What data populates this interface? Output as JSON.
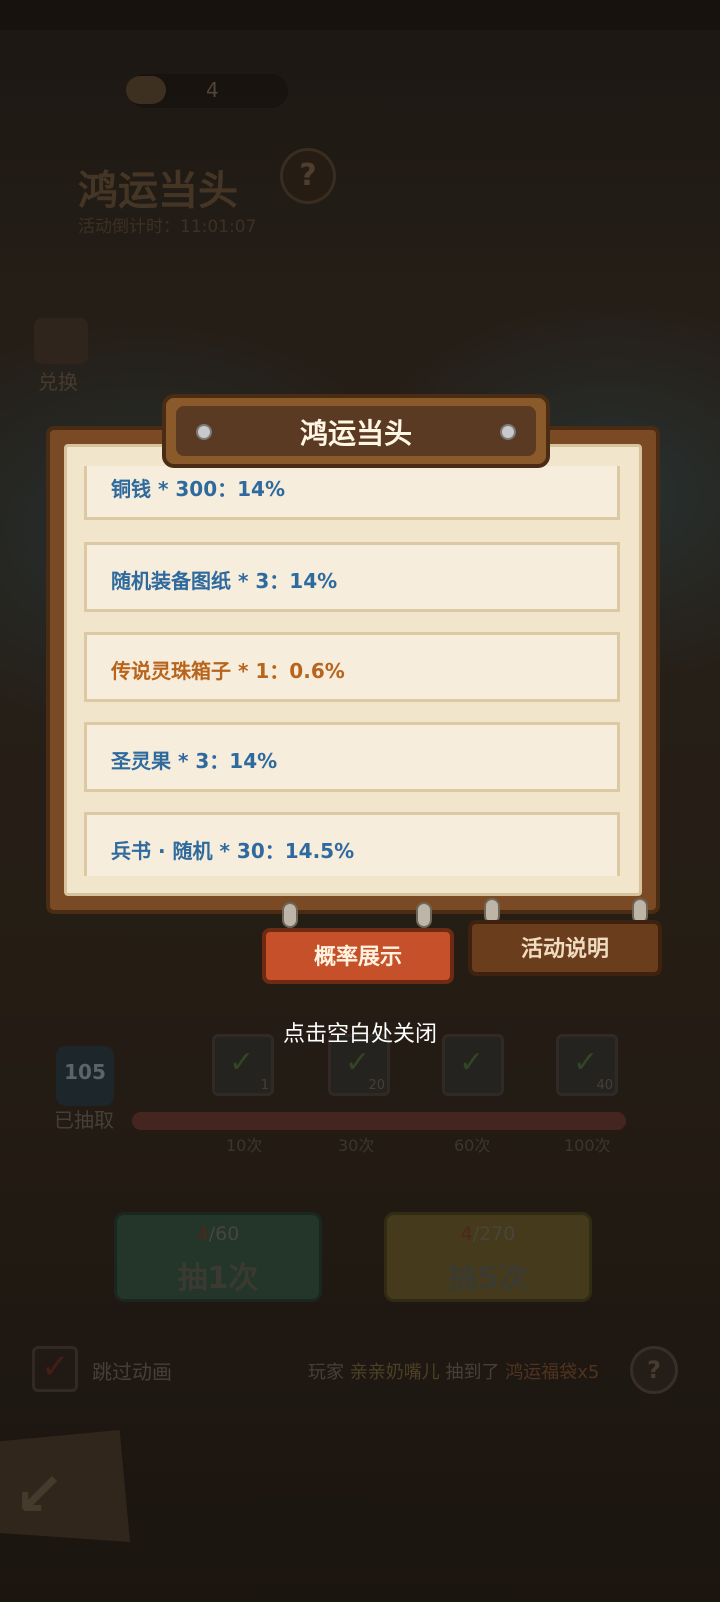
{
  "header": {
    "currency_value": "4",
    "event_title": "鸿运当头",
    "countdown": "活动倒计时：11:01:07",
    "help_icon": "?"
  },
  "side": {
    "exchange_label": "兑换"
  },
  "modal": {
    "title": "鸿运当头",
    "items": [
      {
        "text": "铜钱 * 300：14%",
        "highlight": false
      },
      {
        "text": "随机装备图纸 * 3：14%",
        "highlight": false
      },
      {
        "text": "传说灵珠箱子 * 1：0.6%",
        "highlight": true
      },
      {
        "text": "圣灵果 * 3：14%",
        "highlight": false
      },
      {
        "text": "兵书 · 随机 * 30：14.5%",
        "highlight": false
      }
    ],
    "tabs": {
      "probability": "概率展示",
      "description": "活动说明"
    },
    "close_hint": "点击空白处关闭"
  },
  "progress": {
    "drawn_count": "105",
    "drawn_label": "已抽取",
    "rewards": [
      {
        "check": "✓",
        "qty": "1"
      },
      {
        "check": "✓",
        "qty": "20"
      },
      {
        "check": "✓",
        "qty": ""
      },
      {
        "check": "✓",
        "qty": "40"
      }
    ],
    "milestones": [
      "10次",
      "30次",
      "60次",
      "100次"
    ],
    "fill_fraction": 1.0
  },
  "draw": {
    "one": {
      "cost_current": "4",
      "cost_total": "/60",
      "label": "抽1次"
    },
    "five": {
      "cost_current": "4",
      "cost_total": "/270",
      "label": "抽5次"
    }
  },
  "bottom": {
    "skip_label": "跳过动画",
    "ticker": {
      "prefix": "玩家",
      "player": "亲亲奶嘴儿",
      "mid": "抽到了",
      "reward": "鸿运福袋x5"
    },
    "help_icon": "?"
  },
  "colors": {
    "item_blue": "#2f6a9e",
    "item_orange": "#b8641c",
    "tab_active": "#c6502a",
    "tab_inactive": "#6a3d1c"
  }
}
